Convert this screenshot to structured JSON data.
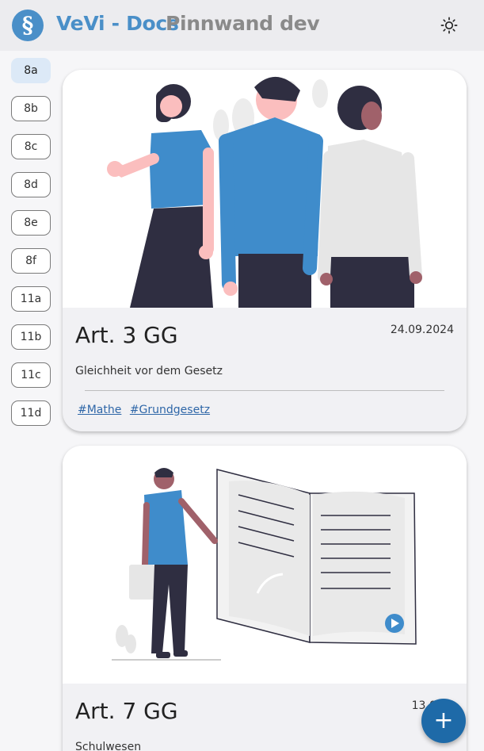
{
  "header": {
    "logo_glyph": "§",
    "app_name": "VeVi - Docs",
    "board_label": "Pinnwand dev",
    "theme_icon": "sun-icon"
  },
  "classes": [
    {
      "label": "8a",
      "active": true
    },
    {
      "label": "8b",
      "active": false
    },
    {
      "label": "8c",
      "active": false
    },
    {
      "label": "8d",
      "active": false
    },
    {
      "label": "8e",
      "active": false
    },
    {
      "label": "8f",
      "active": false
    },
    {
      "label": "11a",
      "active": false
    },
    {
      "label": "11b",
      "active": false
    },
    {
      "label": "11c",
      "active": false
    },
    {
      "label": "11d",
      "active": false
    }
  ],
  "posts": [
    {
      "title": "Art. 3 GG",
      "date": "24.09.2024",
      "description": "Gleichheit vor dem Gesetz",
      "tags": [
        "#Mathe",
        "#Grundgesetz"
      ],
      "illustration": "three-people"
    },
    {
      "title": "Art. 7 GG",
      "date": "13.09.2",
      "description": "Schulwesen",
      "illustration": "open-book"
    }
  ],
  "fab": {
    "label": "+"
  },
  "colors": {
    "accent": "#4a8fc8",
    "fab": "#1e6aa8",
    "active_chip": "#dce9f7"
  }
}
